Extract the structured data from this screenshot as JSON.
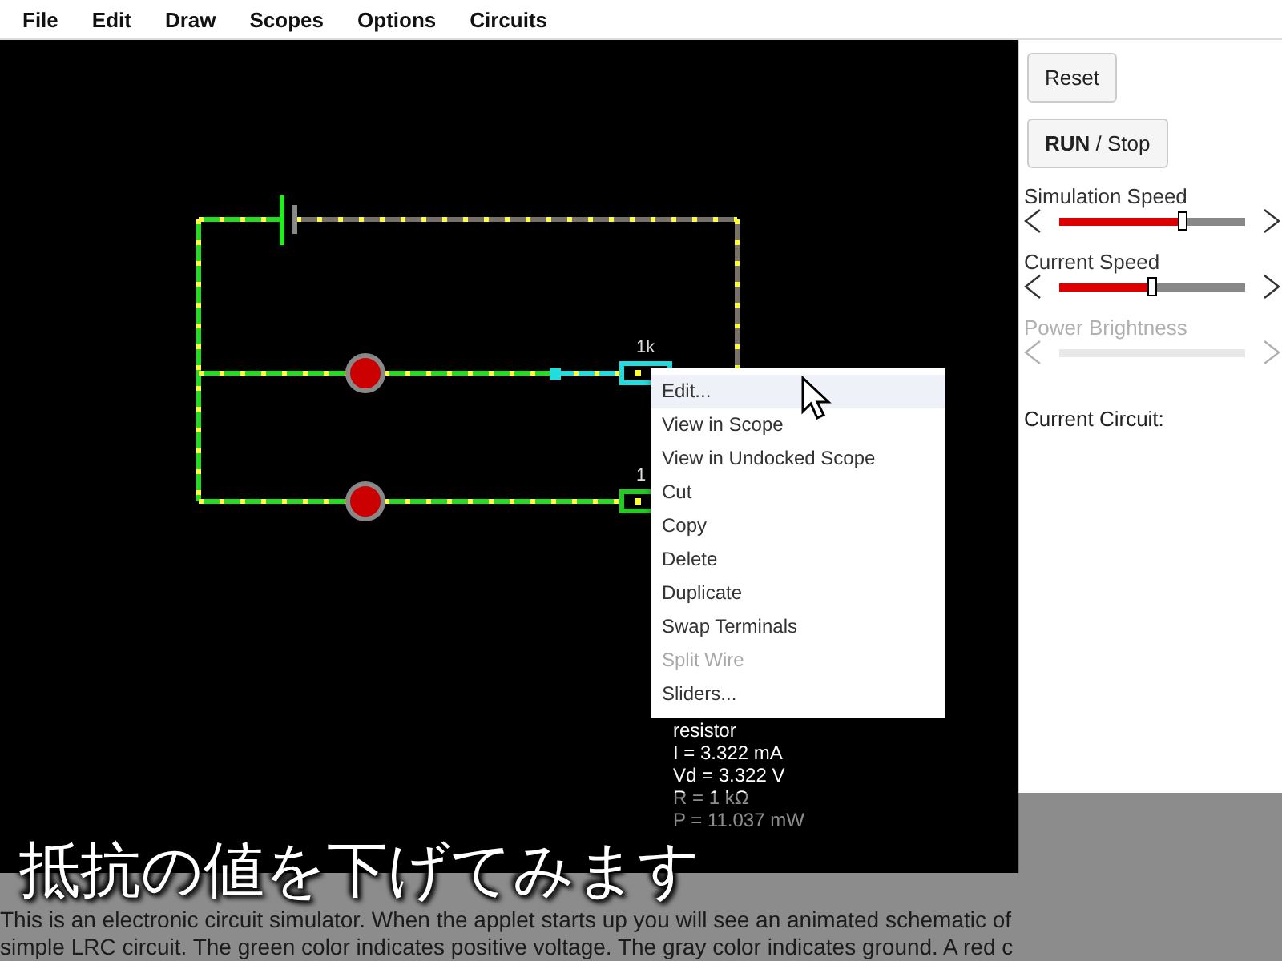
{
  "menu_bar": [
    "File",
    "Edit",
    "Draw",
    "Scopes",
    "Options",
    "Circuits"
  ],
  "circuit": {
    "resistor_labels": [
      "1k",
      "1"
    ],
    "context_menu": [
      {
        "label": "Edit...",
        "highlighted": true,
        "disabled": false
      },
      {
        "label": "View in Scope",
        "highlighted": false,
        "disabled": false
      },
      {
        "label": "View in Undocked Scope",
        "highlighted": false,
        "disabled": false
      },
      {
        "label": "Cut",
        "highlighted": false,
        "disabled": false
      },
      {
        "label": "Copy",
        "highlighted": false,
        "disabled": false
      },
      {
        "label": "Delete",
        "highlighted": false,
        "disabled": false
      },
      {
        "label": "Duplicate",
        "highlighted": false,
        "disabled": false
      },
      {
        "label": "Swap Terminals",
        "highlighted": false,
        "disabled": false
      },
      {
        "label": "Split Wire",
        "highlighted": false,
        "disabled": true
      },
      {
        "label": "Sliders...",
        "highlighted": false,
        "disabled": false
      }
    ],
    "info": [
      "resistor",
      "I = 3.322 mA",
      "Vd = 3.322 V",
      "R = 1 kΩ",
      "P = 11.037 mW"
    ]
  },
  "side_panel": {
    "buttons": [
      "Reset",
      "**RUN** / Stop"
    ],
    "sliders": [
      {
        "label": "Simulation Speed",
        "disabled": false,
        "level": 0.66
      },
      {
        "label": "Current Speed",
        "disabled": false,
        "level": 0.5
      },
      {
        "label": "Power Brightness",
        "disabled": true
      }
    ],
    "current_circuit_label": "Current Circuit:"
  },
  "caption": "抵抗の値を下げてみます",
  "description": [
    "This is an electronic circuit simulator.  When the applet starts up you will see an animated schematic of",
    "simple LRC circuit. The green color indicates positive voltage.  The gray color indicates ground.  A red c"
  ]
}
